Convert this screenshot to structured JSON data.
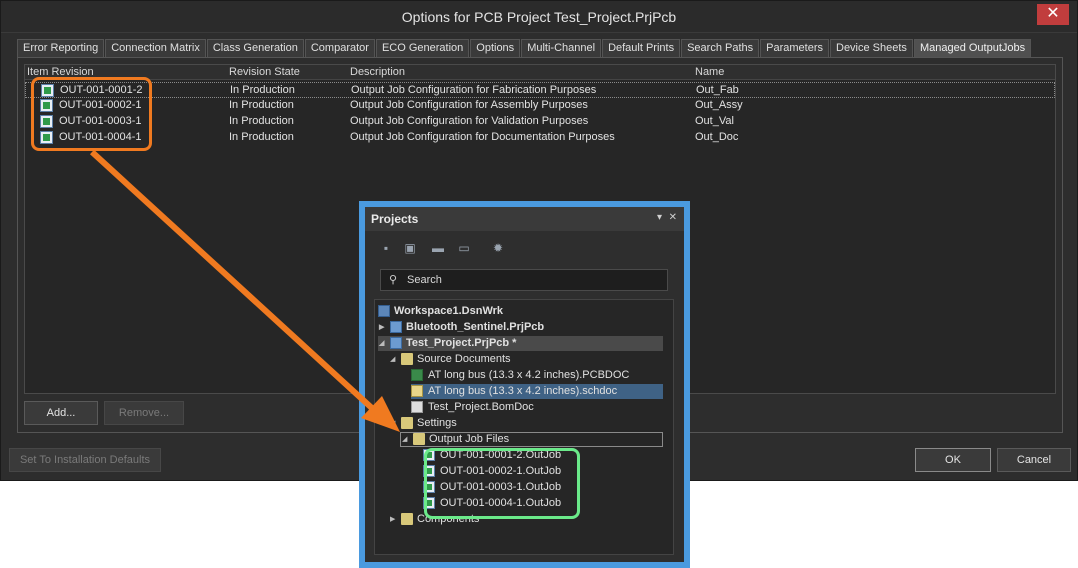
{
  "dialog": {
    "title": "Options for PCB Project Test_Project.PrjPcb",
    "close_label": "✕",
    "tabs": [
      "Error Reporting",
      "Connection Matrix",
      "Class Generation",
      "Comparator",
      "ECO Generation",
      "Options",
      "Multi-Channel",
      "Default Prints",
      "Search Paths",
      "Parameters",
      "Device Sheets",
      "Managed OutputJobs"
    ],
    "active_tab": "Managed OutputJobs",
    "table": {
      "headers": [
        "Item Revision",
        "Revision State",
        "Description",
        "Name"
      ],
      "rows": [
        {
          "item": "OUT-001-0001-2",
          "state": "In Production",
          "desc": "Output Job Configuration for Fabrication Purposes",
          "name": "Out_Fab"
        },
        {
          "item": "OUT-001-0002-1",
          "state": "In Production",
          "desc": "Output Job Configuration for Assembly Purposes",
          "name": "Out_Assy"
        },
        {
          "item": "OUT-001-0003-1",
          "state": "In Production",
          "desc": "Output Job Configuration for Validation Purposes",
          "name": "Out_Val"
        },
        {
          "item": "OUT-001-0004-1",
          "state": "In Production",
          "desc": "Output Job Configuration for Documentation Purposes",
          "name": "Out_Doc"
        }
      ]
    },
    "add_label": "Add...",
    "remove_label": "Remove...",
    "defaults_label": "Set To Installation Defaults",
    "ok_label": "OK",
    "cancel_label": "Cancel"
  },
  "projects": {
    "title": "Projects",
    "dropdown_glyph": "▾",
    "close_glyph": "✕",
    "search_placeholder": "Search",
    "tree": {
      "workspace": "Workspace1.DsnWrk",
      "bluetooth": "Bluetooth_Sentinel.PrjPcb",
      "test_project": "Test_Project.PrjPcb *",
      "source_documents": "Source Documents",
      "pcbdoc": "AT long bus (13.3 x 4.2 inches).PCBDOC",
      "schdoc": "AT long bus (13.3 x 4.2 inches).schdoc",
      "bomdoc": "Test_Project.BomDoc",
      "settings": "Settings",
      "output_job_files": "Output Job Files",
      "outjobs": [
        "OUT-001-0001-2.OutJob",
        "OUT-001-0002-1.OutJob",
        "OUT-001-0003-1.OutJob",
        "OUT-001-0004-1.OutJob"
      ],
      "components": "Components"
    }
  },
  "colors": {
    "highlight_orange": "#f07a20",
    "highlight_green": "#6bea8a",
    "panel_border": "#4a9adf"
  }
}
